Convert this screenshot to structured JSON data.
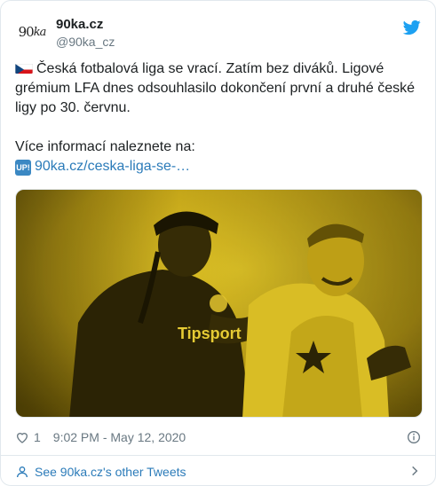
{
  "account": {
    "display_name": "90ka.cz",
    "handle": "@90ka_cz",
    "avatar_text_num": "90",
    "avatar_text_ka": "ka"
  },
  "tweet": {
    "line1": "Česká fotbalová liga se vrací. Zatím bez diváků. Ligové grémium LFA dnes odsouhlasilo dokončení první a druhé české ligy po 30. červnu.",
    "line2": "Více informací naleznete na:",
    "up_badge": "UP!",
    "link_text": "90ka.cz/ceska-liga-se-…",
    "flag_icon": "czech-flag"
  },
  "media": {
    "sponsor_text": "Tipsport",
    "tint_color": "#e3c21a"
  },
  "meta": {
    "likes": "1",
    "timestamp": "9:02 PM - May 12, 2020"
  },
  "footer": {
    "label": "See 90ka.cz's other Tweets"
  },
  "colors": {
    "link": "#2b7bb9",
    "twitter_blue": "#1da1f2",
    "muted": "#697882"
  }
}
